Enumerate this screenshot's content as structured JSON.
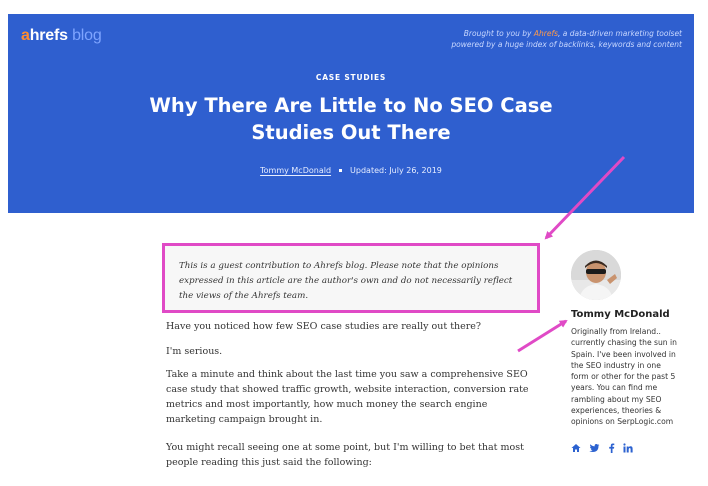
{
  "header": {
    "logo": {
      "a": "a",
      "hrefs": "hrefs",
      "blog": "blog"
    },
    "tagline_prefix": "Brought to you by ",
    "tagline_link": "Ahrefs",
    "tagline_suffix": ", a data-driven marketing toolset powered by a huge index of backlinks, keywords and content",
    "category": "CASE STUDIES",
    "title": "Why There Are Little to No SEO Case Studies Out There",
    "author": "Tommy McDonald",
    "updated": "Updated: July 26, 2019"
  },
  "guest_note": "This is a guest contribution to Ahrefs blog. Please note that the opinions expressed in this article are the author's own and do not necessarily reflect the views of the Ahrefs team.",
  "article": {
    "paragraphs": [
      "Have you noticed how few SEO case studies are really out there?",
      "I'm serious.",
      "Take a minute and think about the last time you saw a comprehensive SEO case study that showed traffic growth, website interaction, conversion rate metrics and most importantly, how much money the search engine marketing campaign brought in.",
      "You might recall seeing one at some point, but I'm willing to bet that most people reading this just said the following:"
    ]
  },
  "sidebar": {
    "author_name": "Tommy McDonald",
    "bio": "Originally from Ireland.. currently chasing the sun in Spain. I've been involved in the SEO industry in one form or other for the past 5 years. You can find me rambling about my SEO experiences, theories & opinions on SerpLogic.com",
    "socials": [
      "home-icon",
      "twitter-icon",
      "facebook-icon",
      "linkedin-icon"
    ]
  },
  "colors": {
    "header_bg": "#2f5fcf",
    "annotation": "#e04ac6",
    "link": "#2c62d0",
    "logo_orange": "#ff8c2f"
  }
}
